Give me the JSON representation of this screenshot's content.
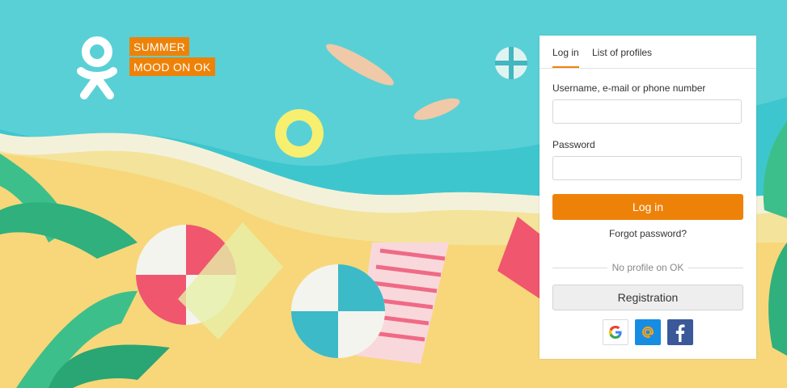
{
  "brand": {
    "logo": "odnoklassniki-logo",
    "promo_line1": "SUMMER",
    "promo_line2": "MOOD ON OK",
    "accent_color": "#ee8208"
  },
  "tabs": [
    {
      "label": "Log in",
      "active": true
    },
    {
      "label": "List of profiles",
      "active": false
    }
  ],
  "form": {
    "username_label": "Username, e-mail or phone number",
    "username_value": "",
    "password_label": "Password",
    "password_value": "",
    "login_button": "Log in",
    "forgot_link": "Forgot password?",
    "divider_text": "No profile on OK",
    "register_button": "Registration"
  },
  "social": [
    {
      "icon": "google-icon"
    },
    {
      "icon": "mail-ru-icon"
    },
    {
      "icon": "facebook-icon"
    }
  ]
}
